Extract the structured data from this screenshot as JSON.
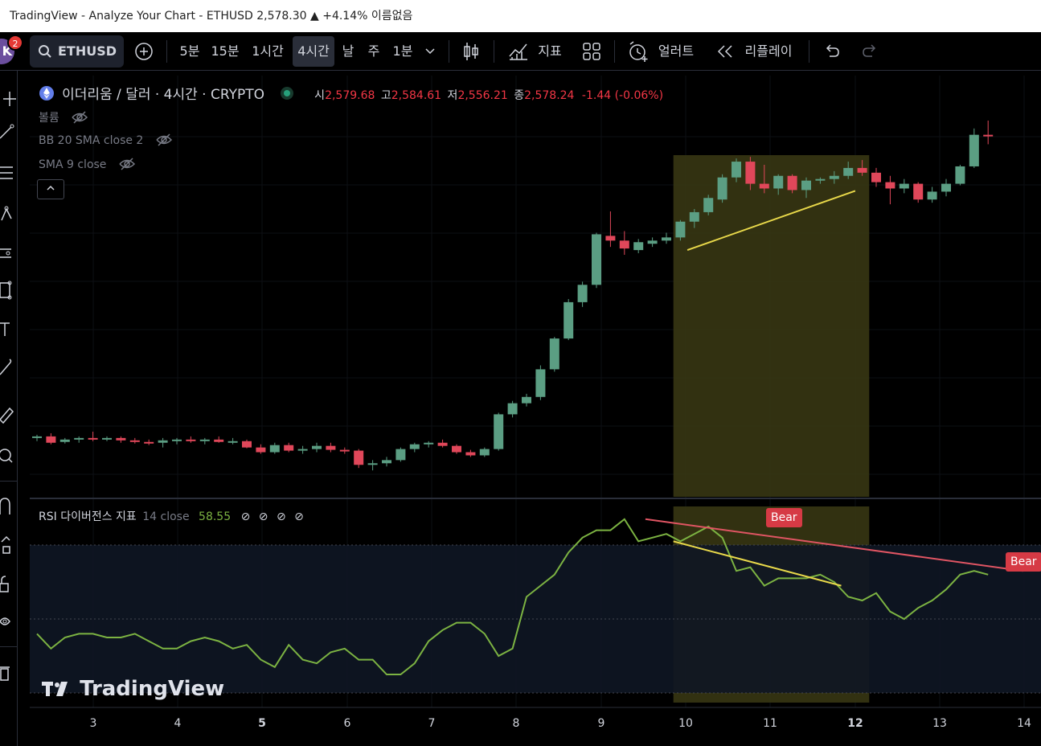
{
  "window": {
    "title": "TradingView - Analyze Your Chart - ETHUSD 2,578.30 ▲ +4.14% 이름없음"
  },
  "toolbar": {
    "avatar_letter": "K",
    "notification_count": "2",
    "symbol": "ETHUSD",
    "intervals": [
      "5분",
      "15분",
      "1시간",
      "4시간",
      "날",
      "주",
      "1분"
    ],
    "active_interval": "4시간",
    "indicators_label": "지표",
    "alert_label": "얼러트",
    "replay_label": "리플레이"
  },
  "legend": {
    "symbol_title": "이더리움 / 달러 · 4시간 · CRYPTO",
    "o_label": "시",
    "o_value": "2,579.68",
    "h_label": "고",
    "h_value": "2,584.61",
    "l_label": "저",
    "l_value": "2,556.21",
    "c_label": "종",
    "c_value": "2,578.24",
    "change": "-1.44 (-0.06%)",
    "indicators": [
      "볼륨",
      "BB 20 SMA close 2",
      "SMA 9 close"
    ]
  },
  "rsi": {
    "name": "RSI 다이버전스 지표",
    "params": "14 close",
    "value": "58.55",
    "bear_label": "Bear"
  },
  "x_axis": {
    "ticks": [
      "3",
      "4",
      "5",
      "6",
      "7",
      "8",
      "9",
      "10",
      "11",
      "12",
      "13",
      "14"
    ],
    "bold_ticks": [
      "5",
      "12"
    ]
  },
  "watermark": "TradingView",
  "colors": {
    "up": "#5b9e83",
    "down": "#e0475a",
    "highlight": "#3b3a14",
    "rsi_line": "#7cb342",
    "divergence_bear": "#e05563",
    "divergence_trend": "#e8d84a",
    "rsi_band": "#0e1624"
  },
  "chart_data": {
    "type": "candlestick",
    "candles": [
      [
        2318,
        2322,
        2314,
        2320
      ],
      [
        2320,
        2324,
        2310,
        2312
      ],
      [
        2313,
        2318,
        2311,
        2316
      ],
      [
        2316,
        2320,
        2312,
        2318
      ],
      [
        2318,
        2326,
        2314,
        2317
      ],
      [
        2317,
        2320,
        2314,
        2318
      ],
      [
        2318,
        2320,
        2312,
        2315
      ],
      [
        2315,
        2318,
        2311,
        2313
      ],
      [
        2313,
        2316,
        2309,
        2312
      ],
      [
        2312,
        2318,
        2306,
        2315
      ],
      [
        2315,
        2318,
        2310,
        2316
      ],
      [
        2316,
        2320,
        2312,
        2314
      ],
      [
        2314,
        2318,
        2310,
        2316
      ],
      [
        2316,
        2320,
        2312,
        2313
      ],
      [
        2313,
        2318,
        2310,
        2314
      ],
      [
        2314,
        2316,
        2305,
        2306
      ],
      [
        2306,
        2310,
        2298,
        2300
      ],
      [
        2300,
        2312,
        2298,
        2309
      ],
      [
        2309,
        2312,
        2300,
        2302
      ],
      [
        2302,
        2308,
        2298,
        2304
      ],
      [
        2304,
        2312,
        2300,
        2308
      ],
      [
        2308,
        2312,
        2300,
        2303
      ],
      [
        2303,
        2306,
        2298,
        2302
      ],
      [
        2302,
        2304,
        2280,
        2284
      ],
      [
        2284,
        2290,
        2277,
        2286
      ],
      [
        2286,
        2294,
        2282,
        2290
      ],
      [
        2290,
        2306,
        2288,
        2304
      ],
      [
        2304,
        2312,
        2300,
        2310
      ],
      [
        2310,
        2314,
        2306,
        2312
      ],
      [
        2312,
        2316,
        2306,
        2308
      ],
      [
        2308,
        2310,
        2298,
        2300
      ],
      [
        2300,
        2303,
        2294,
        2296
      ],
      [
        2296,
        2306,
        2294,
        2304
      ],
      [
        2304,
        2350,
        2302,
        2348
      ],
      [
        2348,
        2365,
        2344,
        2362
      ],
      [
        2362,
        2374,
        2358,
        2370
      ],
      [
        2370,
        2410,
        2366,
        2405
      ],
      [
        2405,
        2446,
        2402,
        2444
      ],
      [
        2444,
        2494,
        2442,
        2490
      ],
      [
        2490,
        2516,
        2484,
        2512
      ],
      [
        2512,
        2578,
        2508,
        2576
      ],
      [
        2574,
        2605,
        2560,
        2568
      ],
      [
        2568,
        2580,
        2550,
        2558
      ],
      [
        2556,
        2570,
        2552,
        2566
      ],
      [
        2564,
        2572,
        2560,
        2568
      ],
      [
        2568,
        2578,
        2564,
        2572
      ],
      [
        2572,
        2594,
        2568,
        2592
      ],
      [
        2592,
        2608,
        2584,
        2604
      ],
      [
        2604,
        2626,
        2600,
        2622
      ],
      [
        2620,
        2652,
        2616,
        2648
      ],
      [
        2648,
        2672,
        2642,
        2668
      ],
      [
        2668,
        2674,
        2632,
        2640
      ],
      [
        2640,
        2664,
        2628,
        2634
      ],
      [
        2634,
        2652,
        2626,
        2650
      ],
      [
        2650,
        2652,
        2628,
        2632
      ],
      [
        2632,
        2648,
        2622,
        2644
      ],
      [
        2644,
        2648,
        2640,
        2646
      ],
      [
        2646,
        2656,
        2640,
        2650
      ],
      [
        2650,
        2668,
        2646,
        2660
      ],
      [
        2660,
        2670,
        2650,
        2654
      ],
      [
        2654,
        2660,
        2636,
        2642
      ],
      [
        2642,
        2650,
        2614,
        2634
      ],
      [
        2634,
        2646,
        2628,
        2640
      ],
      [
        2640,
        2642,
        2616,
        2620
      ],
      [
        2620,
        2636,
        2616,
        2630
      ],
      [
        2630,
        2646,
        2624,
        2640
      ],
      [
        2640,
        2664,
        2638,
        2662
      ],
      [
        2662,
        2710,
        2660,
        2702
      ],
      [
        2702,
        2720,
        2690,
        2700
      ]
    ],
    "rsi": [
      46,
      42,
      45,
      46,
      46,
      45,
      45,
      46,
      44,
      42,
      42,
      44,
      45,
      44,
      42,
      43,
      39,
      37,
      43,
      39,
      38,
      41,
      42,
      39,
      39,
      35,
      35,
      38,
      44,
      47,
      49,
      49,
      46,
      40,
      42,
      56,
      59,
      62,
      68,
      72,
      74,
      74,
      77,
      71,
      72,
      73,
      71,
      73,
      75,
      72,
      63,
      64,
      59,
      61,
      61,
      61,
      62,
      60,
      56,
      55,
      57,
      52,
      50,
      53,
      55,
      58,
      62,
      63,
      62
    ]
  }
}
